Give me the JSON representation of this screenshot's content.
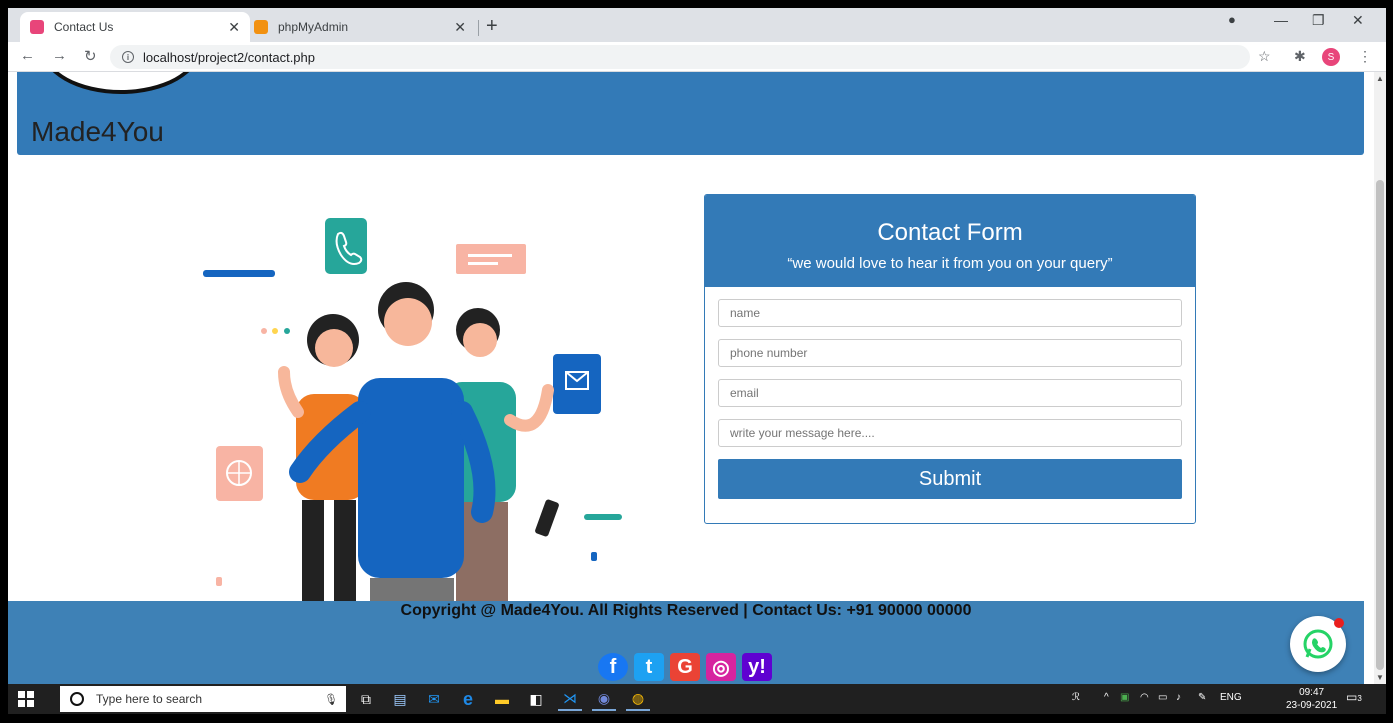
{
  "browser": {
    "tabs": [
      {
        "title": "Contact Us",
        "active": true
      },
      {
        "title": "phpMyAdmin",
        "active": false
      }
    ],
    "address": "localhost/project2/contact.php"
  },
  "site": {
    "brand": "Made4You",
    "form": {
      "title": "Contact Form",
      "subtitle": "“we would love to hear it from you on your query”",
      "name_placeholder": "name",
      "phone_placeholder": "phone number",
      "email_placeholder": "email",
      "message_placeholder": "write your message here....",
      "submit_label": "Submit"
    },
    "footer": {
      "copyright": "Copyright @ Made4You. All Rights Reserved | Contact Us: +91 90000 00000",
      "social_icons": [
        "facebook-icon",
        "twitter-icon",
        "google-icon",
        "instagram-icon",
        "yahoo-icon"
      ]
    }
  },
  "taskbar": {
    "search_placeholder": "Type here to search",
    "language": "ENG",
    "time": "09:47",
    "date": "23-09-2021",
    "notification_count": "3"
  },
  "colors": {
    "primary": "#337ab7",
    "footer": "#3e81b6"
  }
}
